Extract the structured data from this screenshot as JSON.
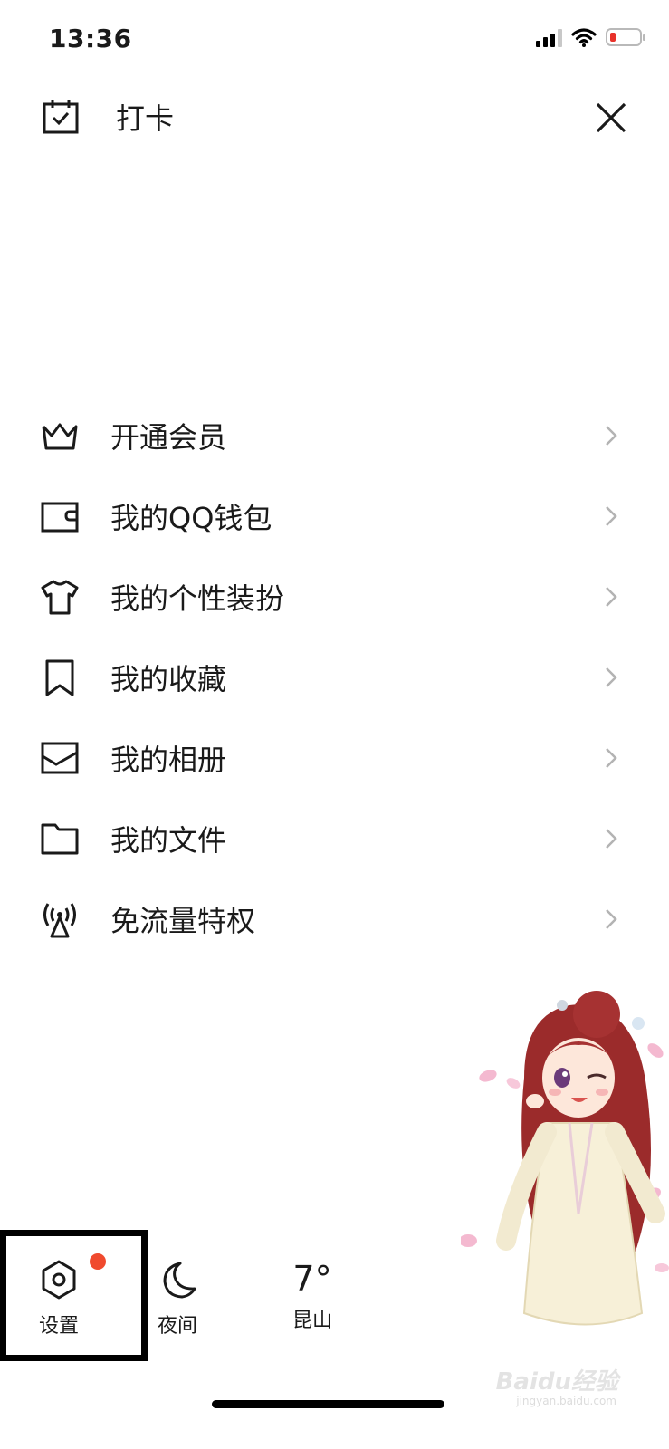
{
  "status": {
    "time": "13:36"
  },
  "header": {
    "checkin_label": "打卡"
  },
  "menu": {
    "items": [
      {
        "label": "开通会员",
        "icon": "crown-icon"
      },
      {
        "label": "我的QQ钱包",
        "icon": "wallet-icon"
      },
      {
        "label": "我的个性装扮",
        "icon": "shirt-icon"
      },
      {
        "label": "我的收藏",
        "icon": "bookmark-icon"
      },
      {
        "label": "我的相册",
        "icon": "photo-icon"
      },
      {
        "label": "我的文件",
        "icon": "folder-icon"
      },
      {
        "label": "免流量特权",
        "icon": "signal-tower-icon"
      }
    ]
  },
  "bottom": {
    "settings_label": "设置",
    "night_label": "夜间",
    "weather_temp": "7°",
    "weather_city": "昆山"
  },
  "watermark": {
    "brand": "Baidu经验",
    "url": "jingyan.baidu.com"
  },
  "colors": {
    "badge": "#f04a2e",
    "battery_low": "#e8322b",
    "text": "#1a1a1a"
  }
}
